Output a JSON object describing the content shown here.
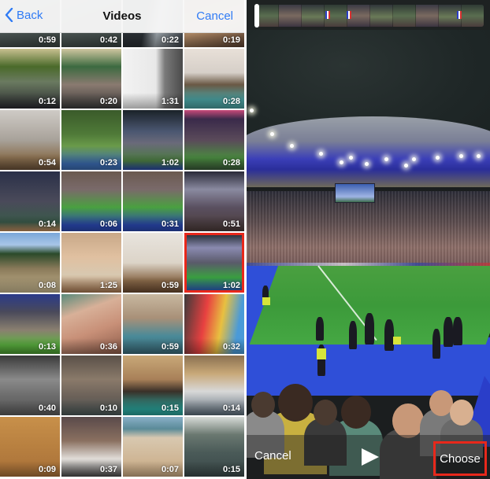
{
  "picker": {
    "nav": {
      "back_label": "Back",
      "title": "Videos",
      "cancel_label": "Cancel",
      "accent_color": "#2f7bf5"
    },
    "videos": [
      {
        "duration": "0:59",
        "scene": "water"
      },
      {
        "duration": "0:42",
        "scene": "water"
      },
      {
        "duration": "0:22",
        "scene": "indoor-dark"
      },
      {
        "duration": "0:19",
        "scene": "indoor-warm"
      },
      {
        "duration": "0:12",
        "scene": "outdoor-party"
      },
      {
        "duration": "0:20",
        "scene": "outdoor-band"
      },
      {
        "duration": "1:31",
        "scene": "white-wall"
      },
      {
        "duration": "0:28",
        "scene": "bedroom"
      },
      {
        "duration": "0:54",
        "scene": "room-dance"
      },
      {
        "duration": "0:23",
        "scene": "garden"
      },
      {
        "duration": "1:02",
        "scene": "stadium-night"
      },
      {
        "duration": "0:28",
        "scene": "stadium-stands"
      },
      {
        "duration": "0:14",
        "scene": "stadium-crowd"
      },
      {
        "duration": "0:06",
        "scene": "stadium-pitch"
      },
      {
        "duration": "0:31",
        "scene": "stadium-pitch"
      },
      {
        "duration": "0:51",
        "scene": "stadium-lights"
      },
      {
        "duration": "0:08",
        "scene": "hill-field"
      },
      {
        "duration": "1:25",
        "scene": "child-desk"
      },
      {
        "duration": "0:59",
        "scene": "child-room"
      },
      {
        "duration": "1:02",
        "scene": "stadium-selected",
        "selected": true
      },
      {
        "duration": "0:13",
        "scene": "stadium-green"
      },
      {
        "duration": "0:36",
        "scene": "face"
      },
      {
        "duration": "0:59",
        "scene": "child-table"
      },
      {
        "duration": "0:32",
        "scene": "slide"
      },
      {
        "duration": "0:40",
        "scene": "parking"
      },
      {
        "duration": "0:10",
        "scene": "cave"
      },
      {
        "duration": "0:15",
        "scene": "cave-sea"
      },
      {
        "duration": "0:14",
        "scene": "boat"
      },
      {
        "duration": "0:09",
        "scene": "sand"
      },
      {
        "duration": "0:37",
        "scene": "kids-play"
      },
      {
        "duration": "0:07",
        "scene": "beach"
      },
      {
        "duration": "0:15",
        "scene": "sea-rocks"
      }
    ],
    "selection_highlight_color": "#e8281b"
  },
  "preview": {
    "cancel_label": "Cancel",
    "play_icon": "play-icon",
    "choose_label": "Choose",
    "choose_highlight_color": "#e8281b"
  }
}
